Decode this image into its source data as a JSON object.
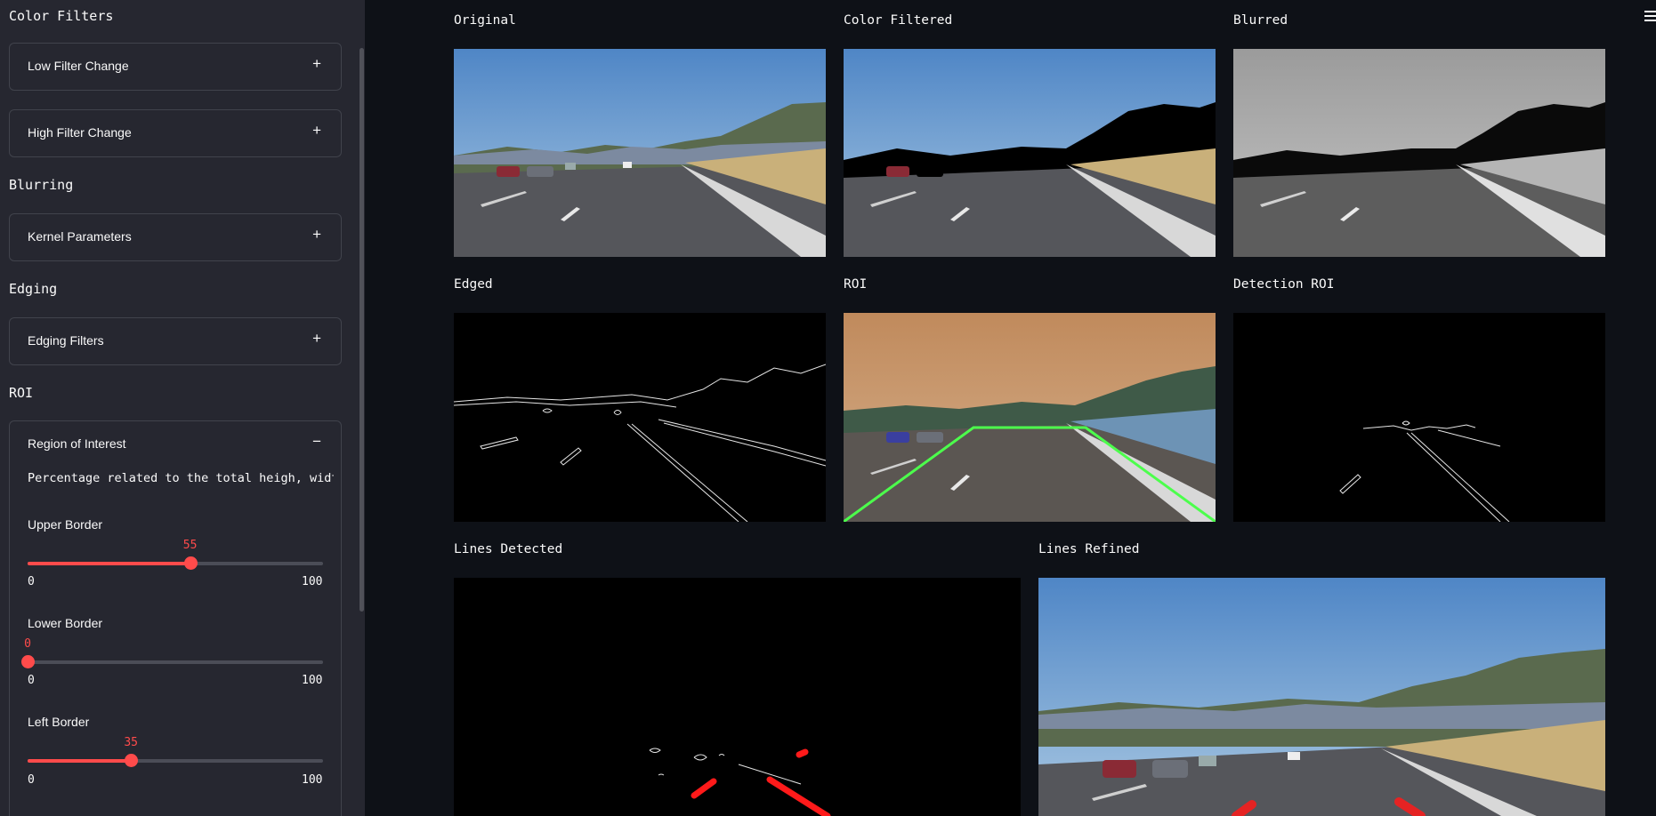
{
  "sidebar": {
    "sections": {
      "color_filters": "Color Filters",
      "blurring": "Blurring",
      "edging": "Edging",
      "roi": "ROI"
    },
    "expanders": {
      "low_filter": {
        "label": "Low Filter Change",
        "toggle": "+"
      },
      "high_filter": {
        "label": "High Filter Change",
        "toggle": "+"
      },
      "kernel": {
        "label": "Kernel Parameters",
        "toggle": "+"
      },
      "edging_filters": {
        "label": "Edging Filters",
        "toggle": "+"
      },
      "region": {
        "label": "Region of Interest",
        "toggle": "−",
        "help": "Percentage related to the total heigh, width of the image"
      }
    },
    "sliders": {
      "upper": {
        "label": "Upper Border",
        "value": "55",
        "min": "0",
        "max": "100",
        "fraction": 0.55
      },
      "lower": {
        "label": "Lower Border",
        "value": "0",
        "min": "0",
        "max": "100",
        "fraction": 0.0
      },
      "left": {
        "label": "Left Border",
        "value": "35",
        "min": "0",
        "max": "100",
        "fraction": 0.35
      }
    }
  },
  "panels": {
    "original": "Original",
    "color_filtered": "Color Filtered",
    "blurred": "Blurred",
    "edged": "Edged",
    "roi": "ROI",
    "detection_roi": "Detection ROI",
    "lines_detected": "Lines Detected",
    "lines_refined": "Lines Refined"
  },
  "icons": {
    "menu": "hamburger-menu-icon"
  },
  "colors": {
    "accent": "#ff4b4b",
    "roi_outline": "#4cff4c",
    "lane_line": "#ff1a1a",
    "background": "#0e1117",
    "sidebar": "#262730"
  }
}
